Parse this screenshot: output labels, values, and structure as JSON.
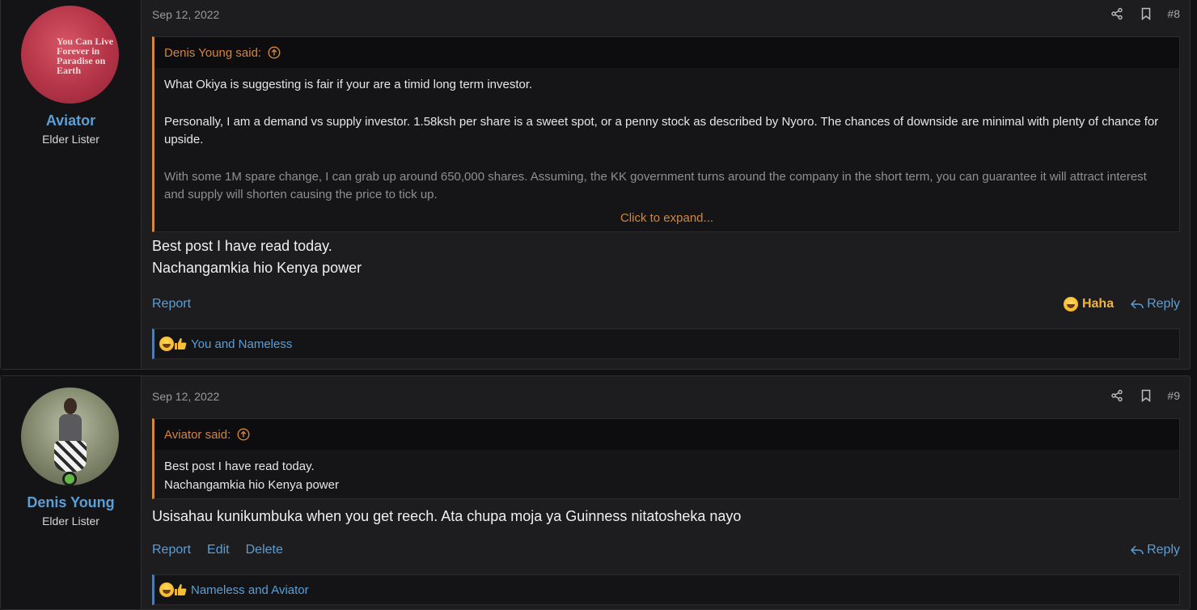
{
  "posts": [
    {
      "author": {
        "name": "Aviator",
        "title": "Elder Lister",
        "avatar_text": "You Can Live Forever in Paradise on Earth"
      },
      "date": "Sep 12, 2022",
      "number": "#8",
      "quote": {
        "header": "Denis Young said:",
        "paragraphs": [
          "What Okiya is suggesting is fair if your are a timid long term investor.",
          "Personally, I am a demand vs supply investor. 1.58ksh per share is a sweet spot, or a penny stock as described by Nyoro. The chances of downside are minimal with plenty of chance for upside.",
          "With some 1M spare change, I can grab up around 650,000 shares. Assuming, the KK government turns around the company in the short term, you can guarantee it will attract interest and supply will shorten causing the price to tick up."
        ],
        "expand_label": "Click to expand..."
      },
      "message": [
        "Best post I have read today.",
        "Nachangamkia hio Kenya power"
      ],
      "actions": {
        "report": "Report",
        "reaction": "Haha",
        "reply": "Reply"
      },
      "reactions_text": "You and Nameless"
    },
    {
      "author": {
        "name": "Denis Young",
        "title": "Elder Lister",
        "online": true
      },
      "date": "Sep 12, 2022",
      "number": "#9",
      "quote": {
        "header": "Aviator said:",
        "paragraphs": [
          "Best post I have read today.",
          "Nachangamkia hio Kenya power"
        ]
      },
      "message": [
        "Usisahau kunikumbuka when you get reech. Ata chupa moja ya Guinness nitatosheka nayo"
      ],
      "actions": {
        "report": "Report",
        "edit": "Edit",
        "delete": "Delete",
        "reply": "Reply"
      },
      "reactions_text": "Nameless and Aviator"
    }
  ],
  "icons": {
    "share": "share-icon",
    "bookmark": "bookmark-icon",
    "quote_up": "arrow-up-circle-icon",
    "reply": "reply-icon",
    "haha": "laughing-emoji-icon",
    "like": "thumbs-up-icon"
  },
  "colors": {
    "background": "#111113",
    "post_bg": "#1d1d1f",
    "link": "#5a9fd6",
    "quote_accent": "#d48a3c",
    "haha": "#f1b43c"
  }
}
